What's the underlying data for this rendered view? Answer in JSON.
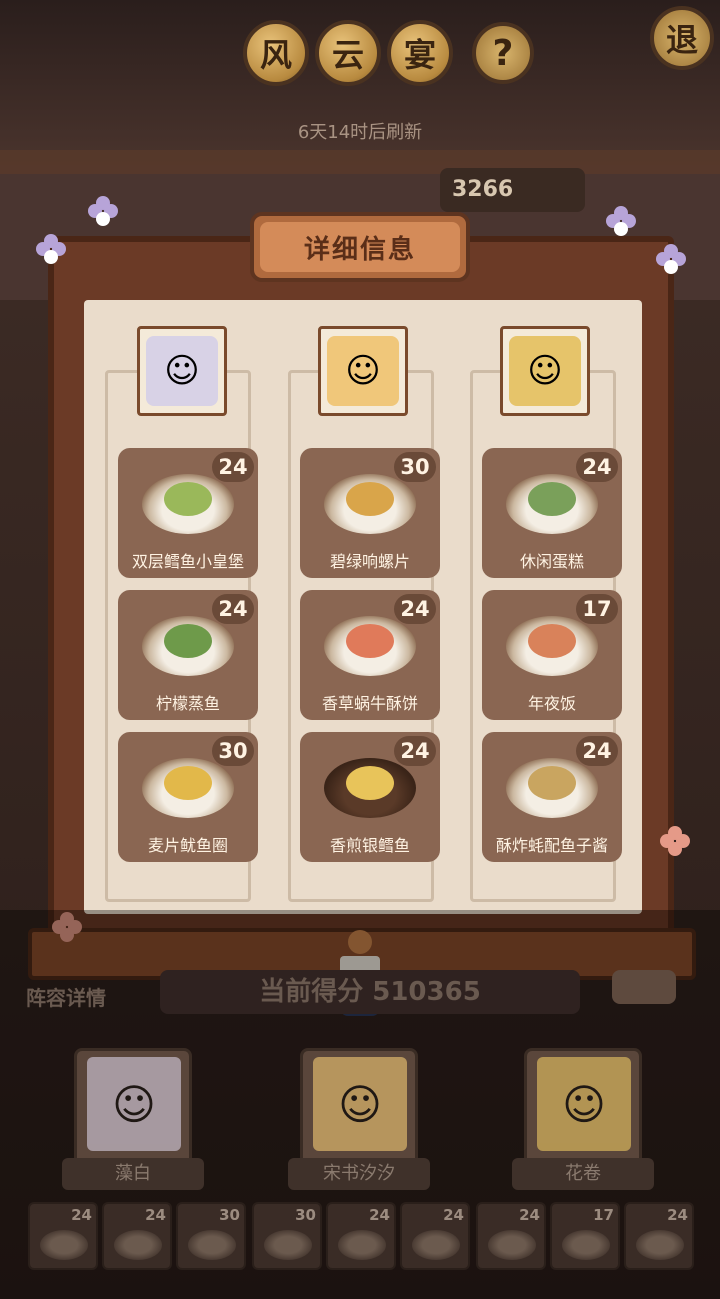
{
  "header": {
    "title_chars": [
      "风",
      "云",
      "宴"
    ],
    "help_label": "?",
    "exit_label": "退",
    "refresh_text": "6天14时后刷新",
    "score_top": "3266"
  },
  "panel": {
    "title": "详细信息"
  },
  "columns": [
    {
      "character_icon": "silver-hair-girl",
      "dishes": [
        {
          "name": "双层鳕鱼小皇堡",
          "count": "24"
        },
        {
          "name": "柠檬蒸鱼",
          "count": "24"
        },
        {
          "name": "麦片鱿鱼圈",
          "count": "30"
        }
      ]
    },
    {
      "character_icon": "blonde-girl-flowers",
      "dishes": [
        {
          "name": "碧绿响螺片",
          "count": "30"
        },
        {
          "name": "香草蜗牛酥饼",
          "count": "24"
        },
        {
          "name": "香煎银鳕鱼",
          "count": "24"
        }
      ]
    },
    {
      "character_icon": "cat-ear-boy",
      "dishes": [
        {
          "name": "休闲蛋糕",
          "count": "24"
        },
        {
          "name": "年夜饭",
          "count": "17"
        },
        {
          "name": "酥炸蚝配鱼子酱",
          "count": "24"
        }
      ]
    }
  ],
  "footer": {
    "lineup_label": "阵容详情",
    "score_text": "当前得分 510365",
    "members": [
      "藻白",
      "宋书汐汐",
      "花卷"
    ],
    "strip_counts": [
      "24",
      "24",
      "30",
      "30",
      "24",
      "24",
      "24",
      "17",
      "24"
    ]
  },
  "colors": {
    "panel_bg": "#eadccb",
    "card_bg": "#8a6652",
    "frame": "#6b3a26",
    "accent_gold": "#d9b56d"
  }
}
